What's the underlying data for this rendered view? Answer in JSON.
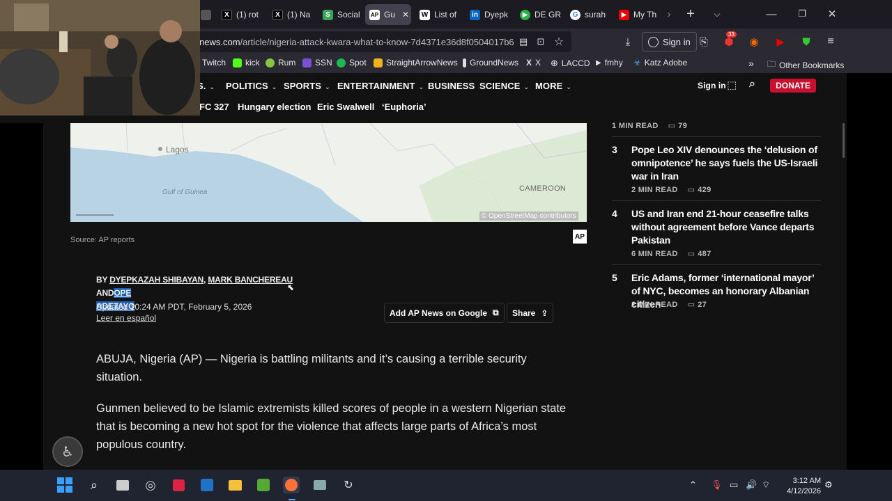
{
  "browser": {
    "tabs": [
      {
        "label": "",
        "icon": "generic"
      },
      {
        "label": "(1) rot",
        "icon": "x-logo"
      },
      {
        "label": "(1) Na",
        "icon": "x-logo"
      },
      {
        "label": "Social",
        "icon": "social"
      },
      {
        "label": "Gu",
        "icon": "ap-logo"
      },
      {
        "label": "List of",
        "icon": "wikipedia"
      },
      {
        "label": "Dyepk",
        "icon": "linkedin"
      },
      {
        "label": "DE GR",
        "icon": "play"
      },
      {
        "label": "surah",
        "icon": "google"
      },
      {
        "label": "My Th",
        "icon": "youtube"
      }
    ],
    "url_host": "news.com",
    "url_path": "/article/nigeria-attack-kwara-what-to-know-7d4371e36d8f0504017b6",
    "sign_in": "Sign in",
    "extension_badge": "33",
    "bookmarks": [
      "Twitch",
      "kick",
      "Rum",
      "SSN",
      "Spot",
      "StraightArrowNews",
      "GroundNews",
      "X",
      "LACCD",
      "fmhy",
      "Katz Adobe"
    ],
    "other_bookmarks": "Other Bookmarks"
  },
  "site": {
    "nav": [
      "S.",
      "POLITICS",
      "SPORTS",
      "ENTERTAINMENT",
      "BUSINESS",
      "SCIENCE",
      "MORE"
    ],
    "sign_in": "Sign in",
    "donate": "DONATE",
    "trending": [
      "FC 327",
      "Hungary election",
      "Eric Swalwell",
      "‘Euphoria’"
    ]
  },
  "map": {
    "labels": [
      "Lagos",
      "Gulf of Guinea",
      "CAMEROON"
    ],
    "attribution": "© OpenStreetMap contributors"
  },
  "article": {
    "source": "Source: AP reports",
    "by": "BY",
    "author1": "DYEPKAZAH SHIBAYAN",
    "comma": ",",
    "author2": "MARK BANCHEREAU",
    "and": "AND",
    "author3a": "OPE",
    "author3b": "ADETAYO",
    "updated": "Updated 10:24 AM PDT, February 5, 2026",
    "spanish": "Leer en español",
    "add_google": "Add AP News on Google",
    "share": "Share",
    "para1": "ABUJA, Nigeria (AP) — Nigeria is battling militants and it’s causing a terrible security situation.",
    "para2": "Gunmen believed to be Islamic extremists killed scores of people in a western Nigerian state that is becoming a new hot spot for the violence that affects large parts of Africa’s most populous country."
  },
  "sidebar": {
    "top_meta": {
      "read": "1 MIN READ",
      "comments": "79"
    },
    "items": [
      {
        "rank": "3",
        "headline": "Pope Leo XIV denounces the ‘delusion of omnipotence’ he says fuels the US-Israeli war in Iran",
        "read": "2 MIN READ",
        "comments": "429"
      },
      {
        "rank": "4",
        "headline": "US and Iran end 21-hour ceasefire talks without agreement before Vance departs Pakistan",
        "read": "6 MIN READ",
        "comments": "487"
      },
      {
        "rank": "5",
        "headline": "Eric Adams, former ‘international mayor’ of NYC, becomes an honorary Albanian citizen",
        "read": "2 MIN READ",
        "comments": "27"
      }
    ]
  },
  "taskbar": {
    "time": "3:12 AM",
    "date": "4/12/2026"
  },
  "colors": {
    "accent": "#c8102e",
    "link_highlight": "#1a5fb4"
  }
}
